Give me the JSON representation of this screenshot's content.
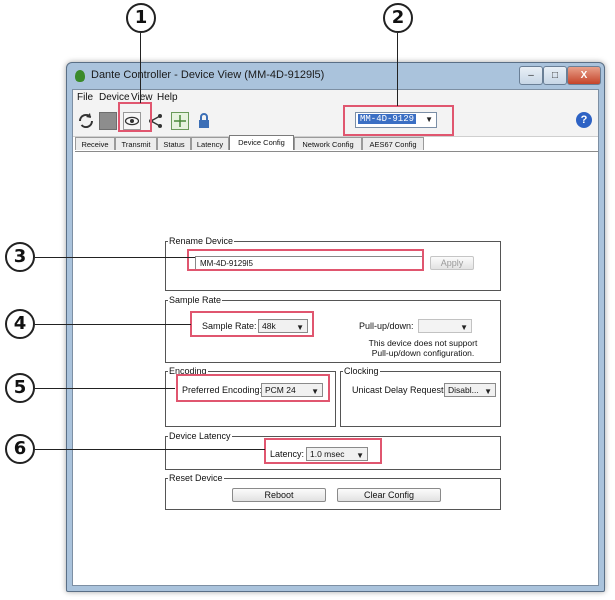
{
  "callouts": [
    "1",
    "2",
    "3",
    "4",
    "5",
    "6"
  ],
  "window": {
    "title": "Dante Controller - Device View (MM-4D-9129l5)",
    "buttons": {
      "minimize": "–",
      "maximize": "□",
      "close": "X"
    }
  },
  "menu": [
    "File",
    "Device",
    "View",
    "Help"
  ],
  "toolbar": {
    "icons": [
      "refresh-icon",
      "device-icon",
      "eye-icon",
      "share-icon",
      "grid-icon",
      "lock-icon"
    ],
    "device_selector": "MM-4D-9129",
    "help": "?"
  },
  "tabs": [
    {
      "label": "Receive",
      "active": false
    },
    {
      "label": "Transmit",
      "active": false
    },
    {
      "label": "Status",
      "active": false
    },
    {
      "label": "Latency",
      "active": false
    },
    {
      "label": "Device Config",
      "active": true
    },
    {
      "label": "Network Config",
      "active": false
    },
    {
      "label": "AES67 Config",
      "active": false
    }
  ],
  "rename_device": {
    "legend": "Rename Device",
    "value": "MM-4D-9129l5",
    "apply": "Apply"
  },
  "sample_rate": {
    "legend": "Sample Rate",
    "label": "Sample Rate:",
    "value": "48k",
    "pullup_label": "Pull-up/down:",
    "pullup_value": "",
    "note_line1": "This device does not support",
    "note_line2": "Pull-up/down configuration."
  },
  "encoding": {
    "legend": "Encoding",
    "label": "Preferred Encoding:",
    "value": "PCM 24"
  },
  "clocking": {
    "legend": "Clocking",
    "label": "Unicast Delay Requests:",
    "value": "Disabl..."
  },
  "device_latency": {
    "legend": "Device Latency",
    "label": "Latency:",
    "value": "1.0 msec"
  },
  "reset_device": {
    "legend": "Reset Device",
    "reboot": "Reboot",
    "clear_config": "Clear Config"
  },
  "colors": {
    "highlight": "#e0566f",
    "selection": "#3b6fc4",
    "window_frame": "#aac3dc"
  }
}
